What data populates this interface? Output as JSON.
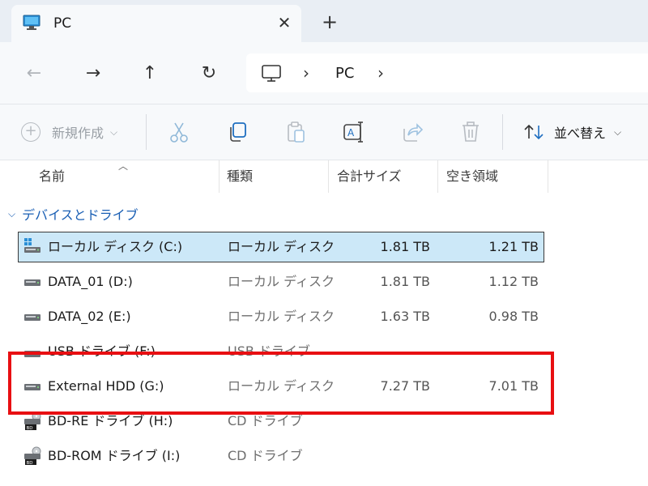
{
  "tab": {
    "title": "PC",
    "close_glyph": "✕",
    "new_tab_glyph": "+"
  },
  "address": {
    "location": "PC",
    "separator": "›"
  },
  "commands": {
    "new_label": "新規作成",
    "sort_label": "並べ替え"
  },
  "columns": {
    "name": "名前",
    "type": "種類",
    "total": "合計サイズ",
    "free": "空き領域"
  },
  "group": {
    "label": "デバイスとドライブ"
  },
  "drives": [
    {
      "name": "ローカル ディスク (C:)",
      "type": "ローカル ディスク",
      "total": "1.81 TB",
      "free": "1.21 TB",
      "icon": "windows-drive-icon",
      "selected": true
    },
    {
      "name": "DATA_01 (D:)",
      "type": "ローカル ディスク",
      "total": "1.81 TB",
      "free": "1.12 TB",
      "icon": "hard-drive-icon"
    },
    {
      "name": "DATA_02 (E:)",
      "type": "ローカル ディスク",
      "total": "1.63 TB",
      "free": "0.98 TB",
      "icon": "hard-drive-icon"
    },
    {
      "name": "USB ドライブ (F:)",
      "type": "USB ドライブ",
      "total": "",
      "free": "",
      "icon": "usb-drive-icon"
    },
    {
      "name": "External HDD (G:)",
      "type": "ローカル ディスク",
      "total": "7.27 TB",
      "free": "7.01 TB",
      "icon": "hard-drive-icon"
    },
    {
      "name": "BD-RE ドライブ (H:)",
      "type": "CD ドライブ",
      "total": "",
      "free": "",
      "icon": "bd-drive-icon"
    },
    {
      "name": "BD-ROM ドライブ (I:)",
      "type": "CD ドライブ",
      "total": "",
      "free": "",
      "icon": "bd-drive-icon"
    }
  ],
  "colors": {
    "selection": "#cce8f8",
    "group_text": "#1a5fb4",
    "highlight": "#e80f12"
  }
}
